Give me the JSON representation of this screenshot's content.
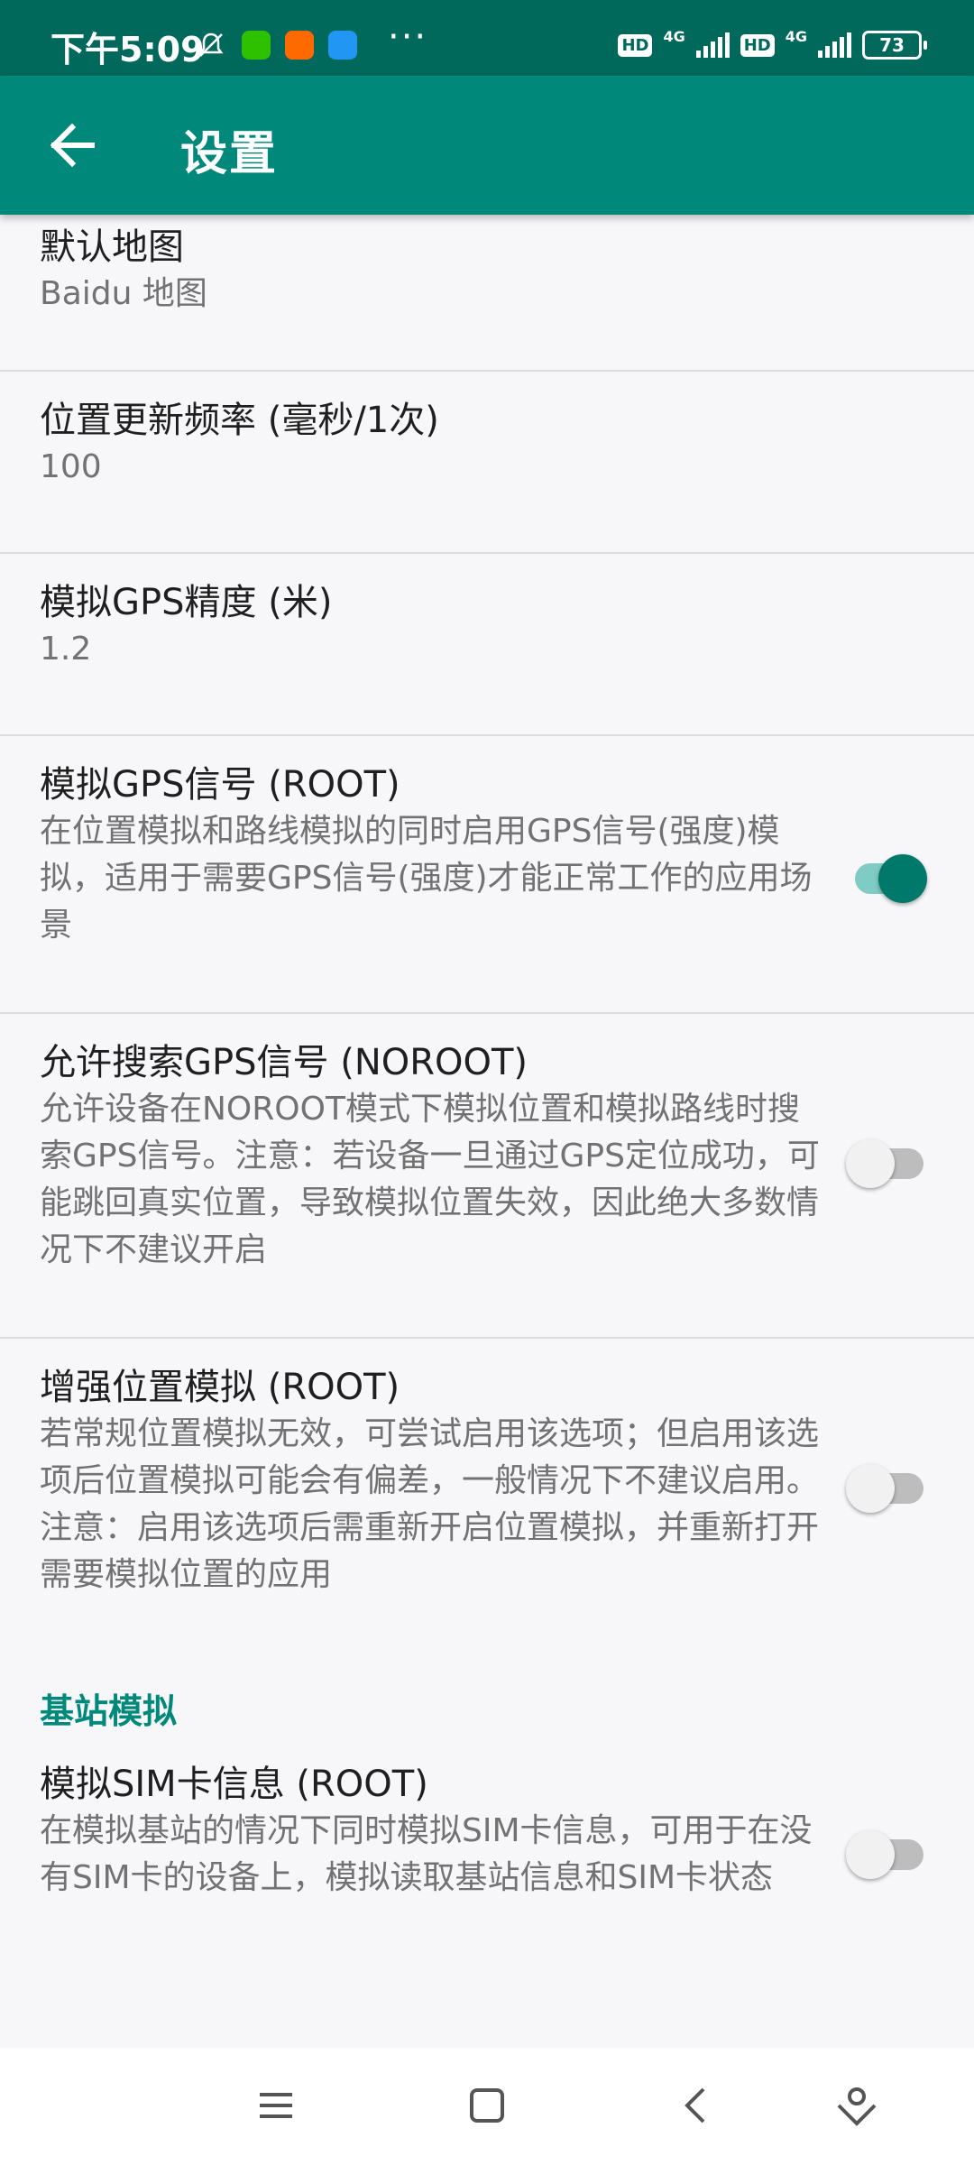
{
  "status_bar": {
    "time": "下午5:09",
    "network_1": "4G",
    "network_2": "4G",
    "hd_label": "HD",
    "battery": "73",
    "more": "···"
  },
  "app_bar": {
    "title": "设置",
    "back_icon": "arrow-left-icon"
  },
  "settings": {
    "default_map": {
      "title": "默认地图",
      "value": "Baidu 地图"
    },
    "update_rate": {
      "title": "位置更新频率 (毫秒/1次)",
      "value": "100"
    },
    "gps_accuracy": {
      "title": "模拟GPS精度 (米)",
      "value": "1.2"
    },
    "gps_signal": {
      "title": "模拟GPS信号 (ROOT)",
      "description": "在位置模拟和路线模拟的同时启用GPS信号(强度)模拟，适用于需要GPS信号(强度)才能正常工作的应用场景",
      "enabled": true
    },
    "allow_search_gps": {
      "title": "允许搜索GPS信号 (NOROOT)",
      "description": "允许设备在NOROOT模式下模拟位置和模拟路线时搜索GPS信号。注意：若设备一旦通过GPS定位成功，可能跳回真实位置，导致模拟位置失效，因此绝大多数情况下不建议开启",
      "enabled": false
    },
    "enhanced_location": {
      "title": "增强位置模拟 (ROOT)",
      "description": "若常规位置模拟无效，可尝试启用该选项；但启用该选项后位置模拟可能会有偏差，一般情况下不建议启用。注意：启用该选项后需重新开启位置模拟，并重新打开需要模拟位置的应用",
      "enabled": false
    }
  },
  "section_base_station": {
    "header": "基站模拟",
    "sim_info": {
      "title": "模拟SIM卡信息 (ROOT)",
      "description": "在模拟基站的情况下同时模拟SIM卡信息，可用于在没有SIM卡的设备上，模拟读取基站信息和SIM卡状态",
      "enabled": false
    }
  },
  "nav_bar": {
    "icons": [
      "menu-icon",
      "home-square-icon",
      "back-chevron-icon",
      "assistant-icon"
    ]
  },
  "colors": {
    "status_bar": "#00695c",
    "app_bar": "#00897b",
    "accent": "#00796b",
    "background": "#f7f7fa"
  }
}
